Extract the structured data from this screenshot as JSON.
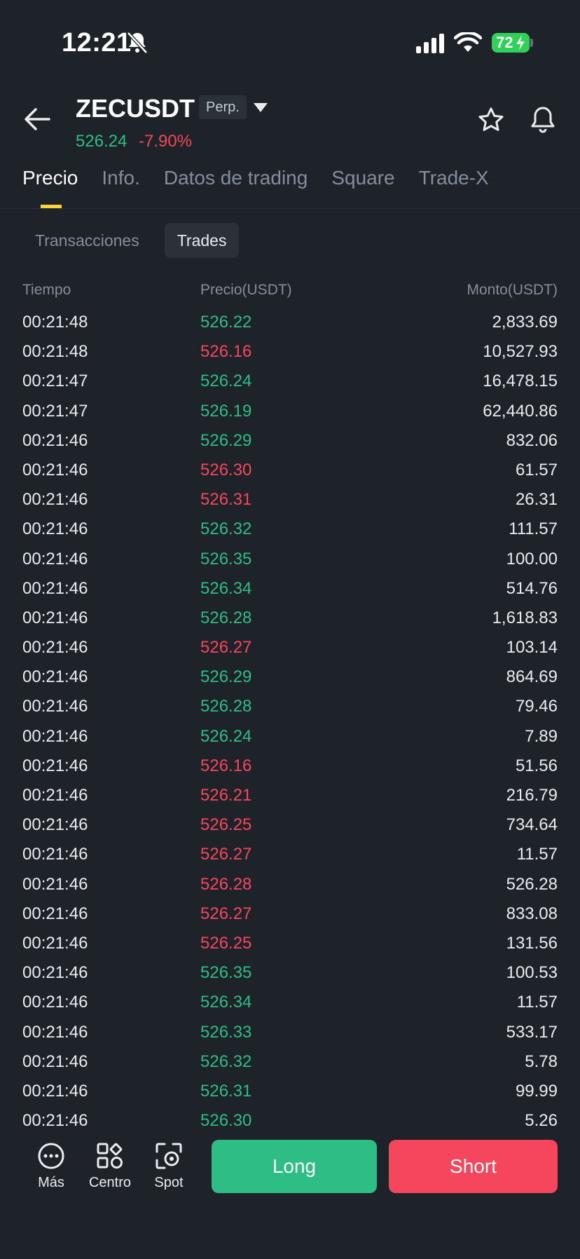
{
  "status_bar": {
    "time": "12:21",
    "battery": "72",
    "icons": [
      "bell-off-icon",
      "signal-icon",
      "wifi-icon",
      "battery-icon"
    ]
  },
  "header": {
    "symbol": "ZECUSDT",
    "contract_type": "Perp.",
    "last_price": "526.24",
    "change_pct": "-7.90%",
    "colors": {
      "up": "#2ebd85",
      "down": "#f6465d",
      "accent": "#fcd535"
    }
  },
  "tabs": [
    {
      "label": "Precio",
      "active": true
    },
    {
      "label": "Info.",
      "active": false
    },
    {
      "label": "Datos de trading",
      "active": false
    },
    {
      "label": "Square",
      "active": false
    },
    {
      "label": "Trade-X",
      "active": false
    }
  ],
  "subtabs": [
    {
      "label": "Transacciones",
      "active": false
    },
    {
      "label": "Trades",
      "active": true
    }
  ],
  "table": {
    "headers": {
      "time": "Tiempo",
      "price": "Precio(USDT)",
      "amount": "Monto(USDT)"
    },
    "rows": [
      {
        "time": "00:21:48",
        "price": "526.22",
        "amount": "2,833.69",
        "side": "buy"
      },
      {
        "time": "00:21:48",
        "price": "526.16",
        "amount": "10,527.93",
        "side": "sell"
      },
      {
        "time": "00:21:47",
        "price": "526.24",
        "amount": "16,478.15",
        "side": "buy"
      },
      {
        "time": "00:21:47",
        "price": "526.19",
        "amount": "62,440.86",
        "side": "buy"
      },
      {
        "time": "00:21:46",
        "price": "526.29",
        "amount": "832.06",
        "side": "buy"
      },
      {
        "time": "00:21:46",
        "price": "526.30",
        "amount": "61.57",
        "side": "sell"
      },
      {
        "time": "00:21:46",
        "price": "526.31",
        "amount": "26.31",
        "side": "sell"
      },
      {
        "time": "00:21:46",
        "price": "526.32",
        "amount": "111.57",
        "side": "buy"
      },
      {
        "time": "00:21:46",
        "price": "526.35",
        "amount": "100.00",
        "side": "buy"
      },
      {
        "time": "00:21:46",
        "price": "526.34",
        "amount": "514.76",
        "side": "buy"
      },
      {
        "time": "00:21:46",
        "price": "526.28",
        "amount": "1,618.83",
        "side": "buy"
      },
      {
        "time": "00:21:46",
        "price": "526.27",
        "amount": "103.14",
        "side": "sell"
      },
      {
        "time": "00:21:46",
        "price": "526.29",
        "amount": "864.69",
        "side": "buy"
      },
      {
        "time": "00:21:46",
        "price": "526.28",
        "amount": "79.46",
        "side": "buy"
      },
      {
        "time": "00:21:46",
        "price": "526.24",
        "amount": "7.89",
        "side": "buy"
      },
      {
        "time": "00:21:46",
        "price": "526.16",
        "amount": "51.56",
        "side": "sell"
      },
      {
        "time": "00:21:46",
        "price": "526.21",
        "amount": "216.79",
        "side": "sell"
      },
      {
        "time": "00:21:46",
        "price": "526.25",
        "amount": "734.64",
        "side": "sell"
      },
      {
        "time": "00:21:46",
        "price": "526.27",
        "amount": "11.57",
        "side": "sell"
      },
      {
        "time": "00:21:46",
        "price": "526.28",
        "amount": "526.28",
        "side": "sell"
      },
      {
        "time": "00:21:46",
        "price": "526.27",
        "amount": "833.08",
        "side": "sell"
      },
      {
        "time": "00:21:46",
        "price": "526.25",
        "amount": "131.56",
        "side": "sell"
      },
      {
        "time": "00:21:46",
        "price": "526.35",
        "amount": "100.53",
        "side": "buy"
      },
      {
        "time": "00:21:46",
        "price": "526.34",
        "amount": "11.57",
        "side": "buy"
      },
      {
        "time": "00:21:46",
        "price": "526.33",
        "amount": "533.17",
        "side": "buy"
      },
      {
        "time": "00:21:46",
        "price": "526.32",
        "amount": "5.78",
        "side": "buy"
      },
      {
        "time": "00:21:46",
        "price": "526.31",
        "amount": "99.99",
        "side": "buy"
      },
      {
        "time": "00:21:46",
        "price": "526.30",
        "amount": "5.26",
        "side": "buy"
      }
    ]
  },
  "bottom_bar": {
    "nav": [
      {
        "label": "Más",
        "icon": "more-icon"
      },
      {
        "label": "Centro",
        "icon": "grid-icon"
      },
      {
        "label": "Spot",
        "icon": "spot-icon"
      }
    ],
    "long_label": "Long",
    "short_label": "Short"
  }
}
